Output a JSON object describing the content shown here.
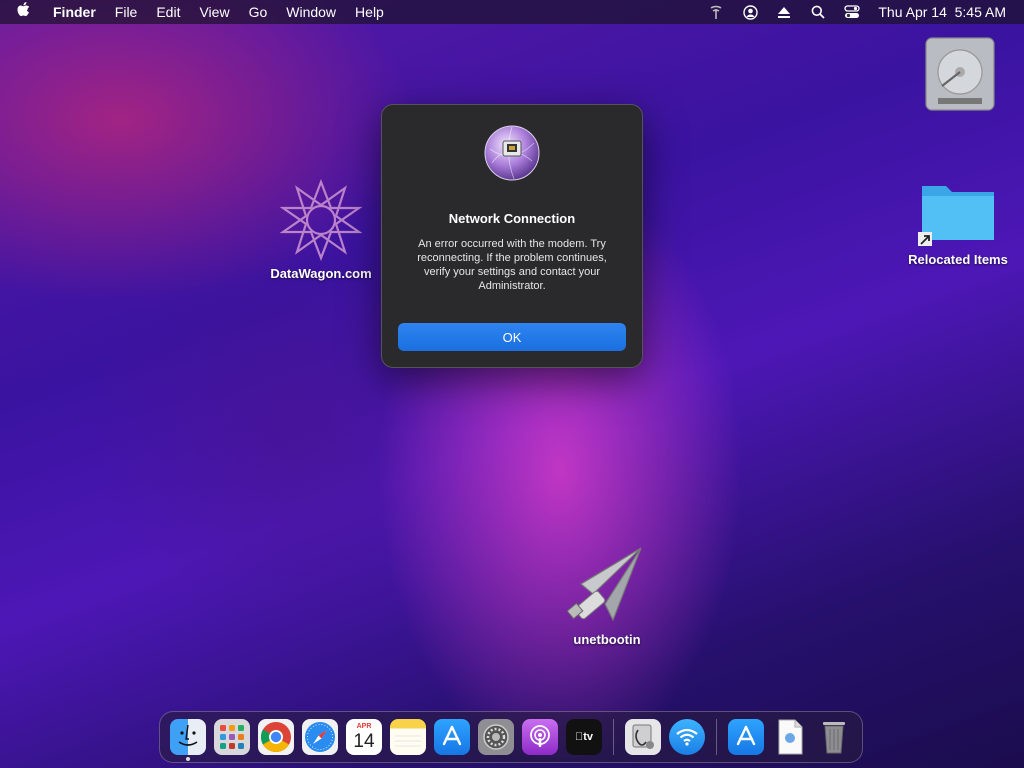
{
  "menubar": {
    "app_name": "Finder",
    "items": [
      "File",
      "Edit",
      "View",
      "Go",
      "Window",
      "Help"
    ],
    "datetime": "Thu Apr 14  5:45 AM"
  },
  "desktop": {
    "icons": [
      {
        "label": "DataWagon.com",
        "icon": "datawagon-icon"
      },
      {
        "label": "Relocated Items",
        "icon": "folder-icon"
      },
      {
        "label": "unetbootin",
        "icon": "unetbootin-icon"
      },
      {
        "label": "",
        "icon": "hard-disk-icon"
      }
    ]
  },
  "dialog": {
    "title": "Network Connection",
    "message": "An error occurred with the modem. Try reconnecting. If the problem continues, verify your settings and contact your Administrator.",
    "ok_label": "OK"
  },
  "dock": {
    "calendar_month": "APR",
    "calendar_day": "14",
    "tv_label": "tv",
    "items": [
      "finder",
      "launchpad",
      "chrome",
      "safari",
      "calendar",
      "notes",
      "app-store",
      "system-preferences",
      "podcasts",
      "apple-tv",
      "disk-utility",
      "wifi-settings",
      "app-store-2",
      "document",
      "trash"
    ]
  },
  "colors": {
    "accent": "#1b6fe0",
    "dialog_bg": "#2a2a2c"
  }
}
